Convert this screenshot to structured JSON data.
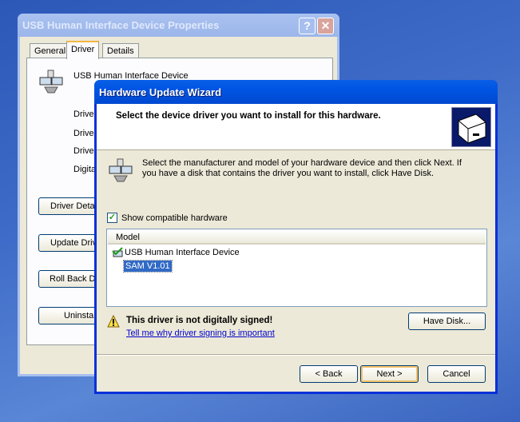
{
  "back_window": {
    "title": "USB Human Interface Device Properties",
    "help": "?",
    "close": "✕",
    "tabs": [
      "General",
      "Driver",
      "Details"
    ],
    "device_name": "USB Human Interface Device",
    "labels": [
      "Driver",
      "Driver",
      "Driver",
      "Digita"
    ],
    "buttons": [
      "Driver Detai",
      "Update Driv",
      "Roll Back Dr",
      "Uninstall"
    ]
  },
  "wizard": {
    "title": "Hardware Update Wizard",
    "heading": "Select the device driver you want to install for this hardware.",
    "instructions": "Select the manufacturer and model of your hardware device and then click Next. If you have a disk that contains the driver you want to install, click Have Disk.",
    "show_compatible_label": "Show compatible hardware",
    "show_compatible_checked": true,
    "list_header": "Model",
    "models": [
      "USB Human Interface Device",
      "SAM V1.01"
    ],
    "selected_index": 1,
    "warning": "This driver is not digitally signed!",
    "warning_link": "Tell me why driver signing is important",
    "have_disk": "Have Disk...",
    "back": "< Back",
    "next": "Next >",
    "cancel": "Cancel"
  }
}
